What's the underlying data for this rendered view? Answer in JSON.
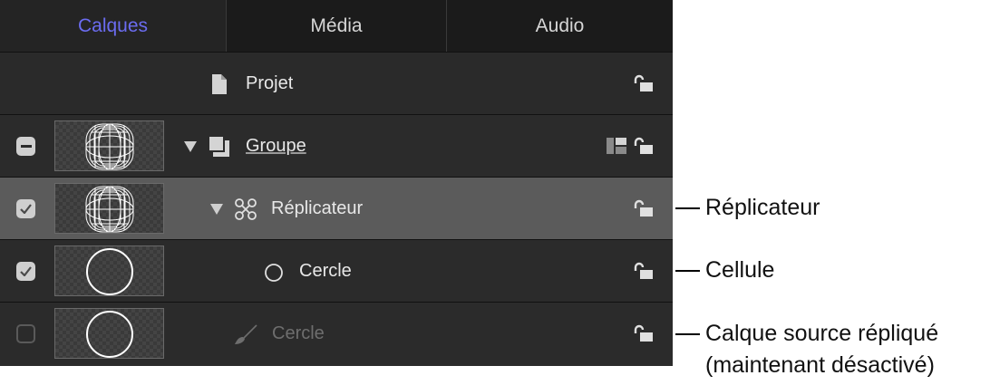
{
  "tabs": [
    {
      "label": "Calques",
      "active": true
    },
    {
      "label": "Média",
      "active": false
    },
    {
      "label": "Audio",
      "active": false
    }
  ],
  "rows": [
    {
      "name": "Projet",
      "icon": "document-icon",
      "lock": "unlocked"
    },
    {
      "name": "Groupe",
      "icon": "group-icon",
      "checkbox": "mixed",
      "expanded": true,
      "lock": "unlocked"
    },
    {
      "name": "Réplicateur",
      "icon": "replicator-icon",
      "checkbox": "checked",
      "expanded": true,
      "selected": true,
      "lock": "unlocked"
    },
    {
      "name": "Cercle",
      "icon": "circle-icon",
      "checkbox": "checked",
      "lock": "unlocked"
    },
    {
      "name": "Cercle",
      "icon": "brush-icon",
      "checkbox": "unchecked",
      "disabled": true,
      "lock": "unlocked"
    }
  ],
  "callouts": {
    "replicator": "Réplicateur",
    "cell": "Cellule",
    "source_line1": "Calque source répliqué",
    "source_line2": "(maintenant désactivé)"
  },
  "colors": {
    "active_tab": "#6b6cf0",
    "panel_bg": "#232323",
    "selected_row": "#5b5b5b"
  }
}
